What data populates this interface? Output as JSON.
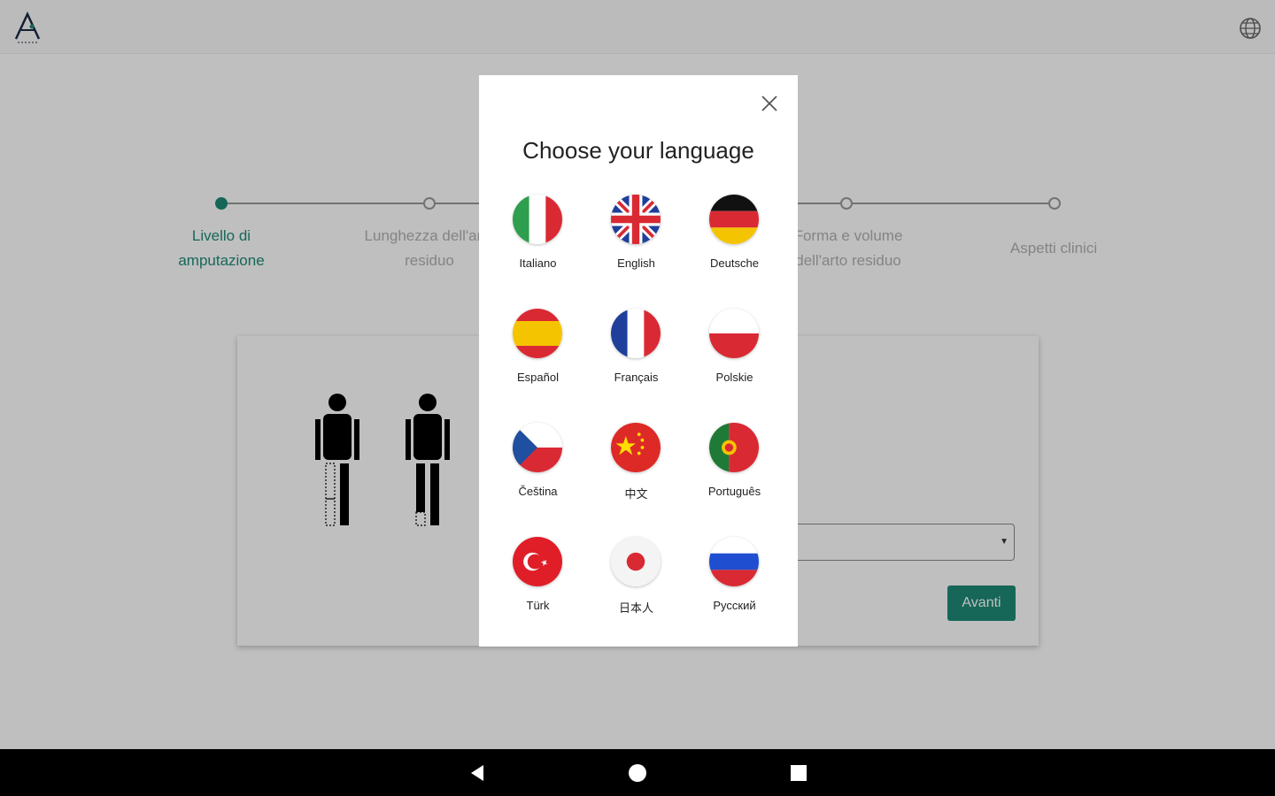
{
  "app": {
    "logo_icon": "app-logo-icon",
    "globe_icon": "globe-icon"
  },
  "stepper": {
    "steps": [
      {
        "label": "Livello di\namputazione",
        "active": true
      },
      {
        "label": "Lunghezza dell'arto\nresiduo",
        "active": false
      },
      {
        "label": "Forma e volume\ndell'arto residuo",
        "active": false
      },
      {
        "label": "Aspetti clinici",
        "active": false
      }
    ]
  },
  "card": {
    "next_button": "Avanti"
  },
  "modal": {
    "title": "Choose your language",
    "close_icon": "close-icon",
    "languages": [
      {
        "label": "Italiano",
        "flag": "italy-flag-icon"
      },
      {
        "label": "English",
        "flag": "uk-flag-icon"
      },
      {
        "label": "Deutsche",
        "flag": "germany-flag-icon"
      },
      {
        "label": "Español",
        "flag": "spain-flag-icon"
      },
      {
        "label": "Français",
        "flag": "france-flag-icon"
      },
      {
        "label": "Polskie",
        "flag": "poland-flag-icon"
      },
      {
        "label": "Čeština",
        "flag": "czech-flag-icon"
      },
      {
        "label": "中文",
        "flag": "china-flag-icon"
      },
      {
        "label": "Português",
        "flag": "portugal-flag-icon"
      },
      {
        "label": "Türk",
        "flag": "turkey-flag-icon"
      },
      {
        "label": "日本人",
        "flag": "japan-flag-icon"
      },
      {
        "label": "Русский",
        "flag": "russia-flag-icon"
      }
    ]
  },
  "navbar": {
    "back_icon": "back-triangle-icon",
    "home_icon": "home-circle-icon",
    "recents_icon": "recents-square-icon"
  },
  "colors": {
    "accent": "#1e8a76",
    "overlay": "rgba(0,0,0,0.25)"
  }
}
